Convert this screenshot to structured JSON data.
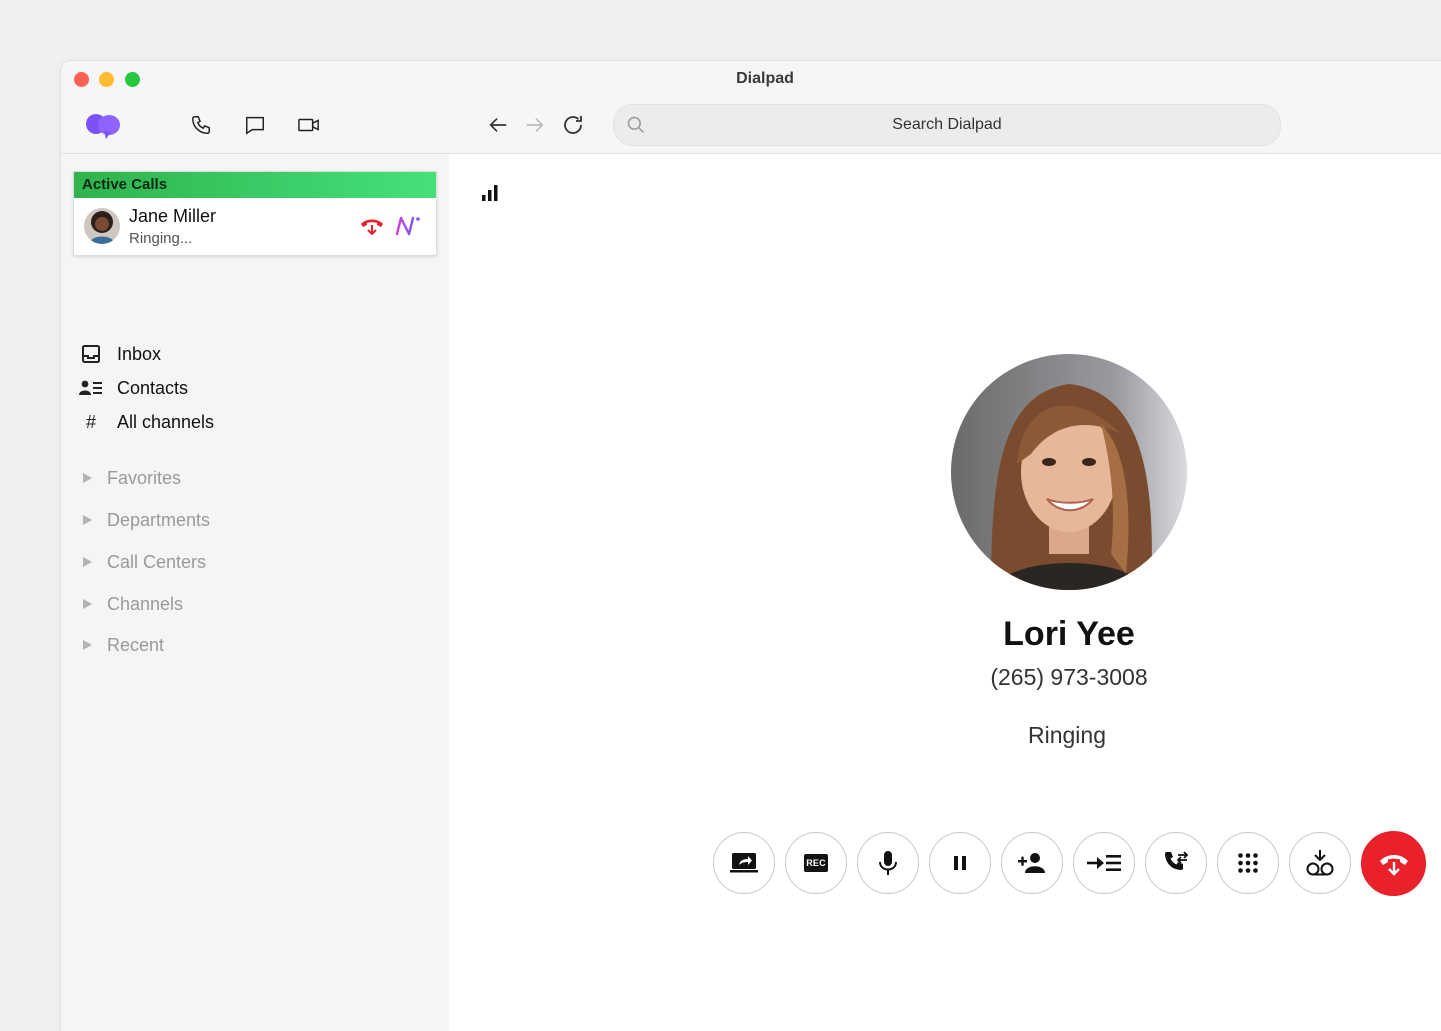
{
  "window": {
    "title": "Dialpad"
  },
  "toolbar": {
    "search_placeholder": "Search Dialpad",
    "icons": [
      "dialpad-logo",
      "phone-icon",
      "message-icon",
      "video-icon",
      "back-arrow-icon",
      "forward-arrow-icon",
      "refresh-icon",
      "search-icon"
    ]
  },
  "sidebar": {
    "active_calls": {
      "header": "Active Calls",
      "call": {
        "name": "Jane Miller",
        "status": "Ringing..."
      }
    },
    "nav": [
      {
        "label": "Inbox",
        "icon": "inbox-icon"
      },
      {
        "label": "Contacts",
        "icon": "contacts-icon"
      },
      {
        "label": "All channels",
        "icon": "hash-icon"
      }
    ],
    "groups": [
      {
        "label": "Favorites"
      },
      {
        "label": "Departments"
      },
      {
        "label": "Call Centers"
      },
      {
        "label": "Channels"
      },
      {
        "label": "Recent"
      }
    ]
  },
  "main": {
    "contact": {
      "name": "Lori Yee",
      "phone": "(265) 973-3008",
      "status": "Ringing"
    },
    "controls": [
      "share-screen-icon",
      "record-icon",
      "microphone-icon",
      "pause-icon",
      "add-person-icon",
      "transfer-icon",
      "call-swap-icon",
      "keypad-icon",
      "voicemail-drop-icon",
      "hang-up-icon"
    ],
    "record_label": "REC"
  },
  "colors": {
    "accent_purple": "#7c52f4",
    "active_green": "#3fd16a",
    "end_call_red": "#e8212a"
  }
}
